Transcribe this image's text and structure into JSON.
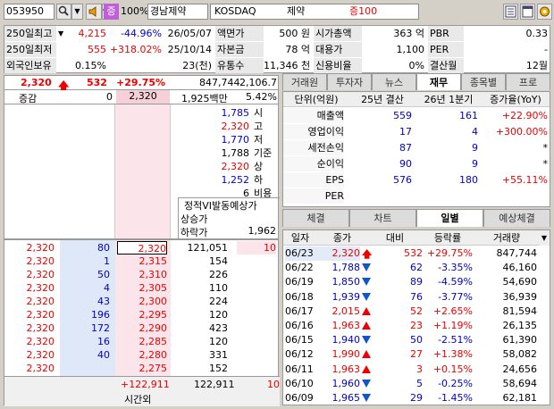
{
  "header": {
    "code": "053950",
    "zoom": "100%",
    "name": "경남제약",
    "market": "KOSDAQ",
    "sector": "제약",
    "margin": "증100",
    "certificate": "증"
  },
  "info": [
    {
      "l1": "250일최고",
      "v1": "4,215",
      "p1": "-44.96%",
      "d1": "26/05/07",
      "l2": "액면가",
      "v2": "500 원",
      "l3": "시가총액",
      "v3": "363 억",
      "l4": "PBR",
      "v4": "0.33"
    },
    {
      "l1": "250일최저",
      "v1": "555",
      "p1": "+318.02%",
      "d1": "25/10/14",
      "l2": "자본금",
      "v2": "78 억",
      "l3": "대용가",
      "v3": "1,100",
      "l4": "PER",
      "v4": "-"
    },
    {
      "l1": "외국인보유",
      "v1": "0.15%",
      "p1": "",
      "d1": "23(천)",
      "l2": "유통수",
      "v2": "11,346 천",
      "l3": "신용비율",
      "v3": "0%",
      "l4": "결산월",
      "v4": "12월"
    }
  ],
  "price": {
    "cur": "2,320",
    "chg": "532",
    "rate": "+29.75%",
    "vol": "847,744",
    "prev": "2,106.7"
  },
  "summary": {
    "label": "증감",
    "zero": "0",
    "px": "2,320",
    "amt": "1,925백만",
    "ratio": "5.42%"
  },
  "stats": [
    {
      "v": "1,785",
      "k": "시",
      "c": "blue"
    },
    {
      "v": "2,320",
      "k": "고",
      "c": "red"
    },
    {
      "v": "1,770",
      "k": "저",
      "c": "blue"
    },
    {
      "v": "1,788",
      "k": "기준",
      "c": "black"
    },
    {
      "v": "2,320",
      "k": "상",
      "c": "red"
    },
    {
      "v": "1,252",
      "k": "하",
      "c": "blue"
    },
    {
      "v": "6",
      "k": "비용",
      "c": "black"
    }
  ],
  "vi": {
    "title": "정적VI발동예상가",
    "up": "상승가",
    "down": "하락가",
    "down_v": "1,962"
  },
  "book": {
    "prices": [
      "2,320",
      "2,315",
      "2,310",
      "2,305",
      "2,300",
      "2,295",
      "2,290",
      "2,285",
      "2,280",
      "2,275"
    ],
    "bid_qty": [
      "121,051",
      "154",
      "226",
      "110",
      "224",
      "120",
      "423",
      "120",
      "331",
      "152"
    ],
    "first_flag": "10",
    "trade_px": [
      "2,320",
      "2,320",
      "2,320",
      "2,320",
      "2,320",
      "2,320",
      "2,320",
      "2,320",
      "2,320",
      "2,320"
    ],
    "trade_qty": [
      "80",
      "1",
      "50",
      "4",
      "43",
      "196",
      "172",
      "16",
      "40"
    ],
    "total_diff": "+122,911",
    "total_qty": "122,911",
    "total_flag": "10",
    "time_label": "시간외"
  },
  "tabs_top": [
    "거래원",
    "투자자",
    "뉴스",
    "재무",
    "종목별",
    "프로"
  ],
  "fin": {
    "headers": [
      "단위(억원)",
      "25년 결산",
      "26년 1분기",
      "증가율(YoY)"
    ],
    "rows": [
      {
        "k": "매출액",
        "a": "559",
        "b": "161",
        "c": "+22.90%",
        "cc": "red"
      },
      {
        "k": "영업이익",
        "a": "17",
        "b": "4",
        "c": "+300.00%",
        "cc": "red"
      },
      {
        "k": "세전손익",
        "a": "87",
        "b": "9",
        "c": "*",
        "cc": "black"
      },
      {
        "k": "순이익",
        "a": "90",
        "b": "9",
        "c": "*",
        "cc": "black"
      },
      {
        "k": "EPS",
        "a": "576",
        "b": "180",
        "c": "+55.11%",
        "cc": "red"
      },
      {
        "k": "PER",
        "a": "",
        "b": "",
        "c": "",
        "cc": "black"
      }
    ]
  },
  "tabs_bottom": [
    "체결",
    "차트",
    "일별",
    "예상체결"
  ],
  "daily": {
    "headers": [
      "일자",
      "종가",
      "대비",
      "등락률",
      "거래량"
    ],
    "rows": [
      {
        "d": "06/23",
        "p": "2,320",
        "dir": "up2",
        "ch": "532",
        "r": "+29.75%",
        "v": "847,744",
        "col": "red"
      },
      {
        "d": "06/22",
        "p": "1,788",
        "dir": "dn",
        "ch": "62",
        "r": "-3.35%",
        "v": "46,160",
        "col": "blue"
      },
      {
        "d": "06/19",
        "p": "1,850",
        "dir": "dn",
        "ch": "89",
        "r": "-4.59%",
        "v": "54,690",
        "col": "blue"
      },
      {
        "d": "06/18",
        "p": "1,939",
        "dir": "dn",
        "ch": "76",
        "r": "-3.77%",
        "v": "36,939",
        "col": "blue"
      },
      {
        "d": "06/17",
        "p": "2,015",
        "dir": "up",
        "ch": "52",
        "r": "+2.65%",
        "v": "81,594",
        "col": "red"
      },
      {
        "d": "06/16",
        "p": "1,963",
        "dir": "up",
        "ch": "23",
        "r": "+1.19%",
        "v": "26,135",
        "col": "red"
      },
      {
        "d": "06/15",
        "p": "1,940",
        "dir": "dn",
        "ch": "50",
        "r": "-2.51%",
        "v": "61,390",
        "col": "blue"
      },
      {
        "d": "06/12",
        "p": "1,990",
        "dir": "up",
        "ch": "27",
        "r": "+1.38%",
        "v": "58,082",
        "col": "red"
      },
      {
        "d": "06/11",
        "p": "1,963",
        "dir": "up",
        "ch": "3",
        "r": "+0.15%",
        "v": "24,656",
        "col": "red"
      },
      {
        "d": "06/10",
        "p": "1,960",
        "dir": "dn",
        "ch": "5",
        "r": "-0.25%",
        "v": "58,694",
        "col": "blue"
      },
      {
        "d": "06/09",
        "p": "1,965",
        "dir": "dn",
        "ch": "29",
        "r": "-1.45%",
        "v": "62,181",
        "col": "blue"
      }
    ]
  }
}
